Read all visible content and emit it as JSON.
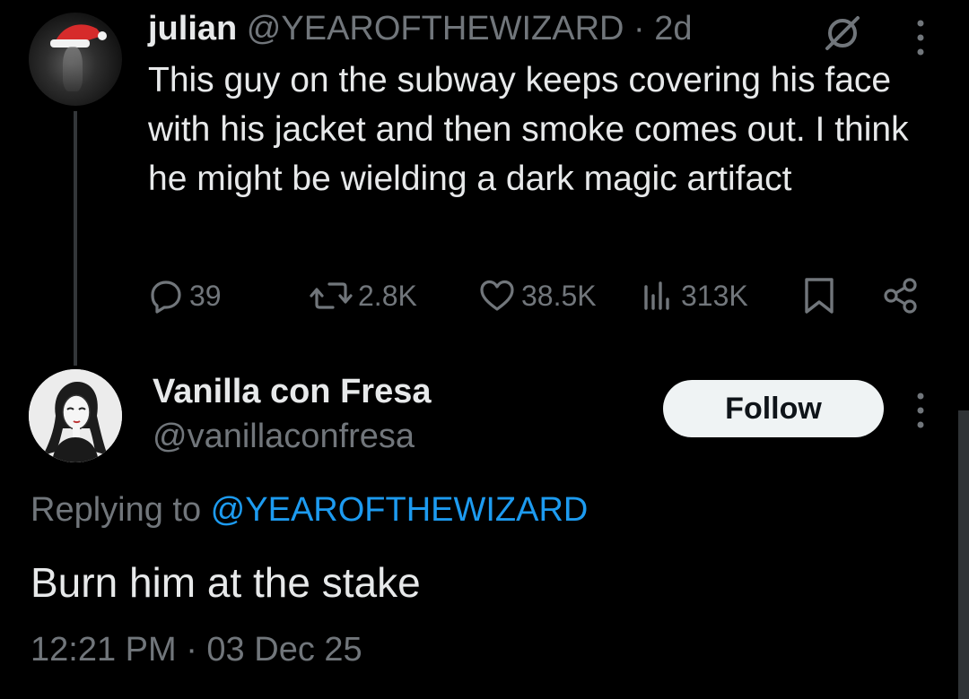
{
  "tweet1": {
    "display_name": "julian",
    "handle": "@YEAROFTHEWIZARD",
    "separator": " · ",
    "time": "2d",
    "text": "This guy on the subway keeps covering his face with his jacket and then smoke comes out. I think he might be wielding a dark magic artifact",
    "stats": {
      "replies": "39",
      "reposts": "2.8K",
      "likes": "38.5K",
      "views": "313K"
    }
  },
  "tweet2": {
    "display_name": "Vanilla con Fresa",
    "handle": "@vanillaconfresa",
    "follow_label": "Follow",
    "replying_prefix": "Replying to ",
    "replying_handle": "@YEAROFTHEWIZARD",
    "text": "Burn him at the stake",
    "timestamp": "12:21 PM · 03 Dec 25"
  },
  "colors": {
    "background": "#000000",
    "text_primary": "#e7e9ea",
    "text_secondary": "#71767b",
    "link": "#1d9bf0",
    "follow_bg": "#eff3f4"
  },
  "icons": {
    "reply": "reply-icon",
    "repost": "repost-icon",
    "like": "heart-icon",
    "views": "views-icon",
    "bookmark": "bookmark-icon",
    "share": "share-icon",
    "grok": "slash-circle-icon",
    "more": "more-vertical-icon"
  }
}
